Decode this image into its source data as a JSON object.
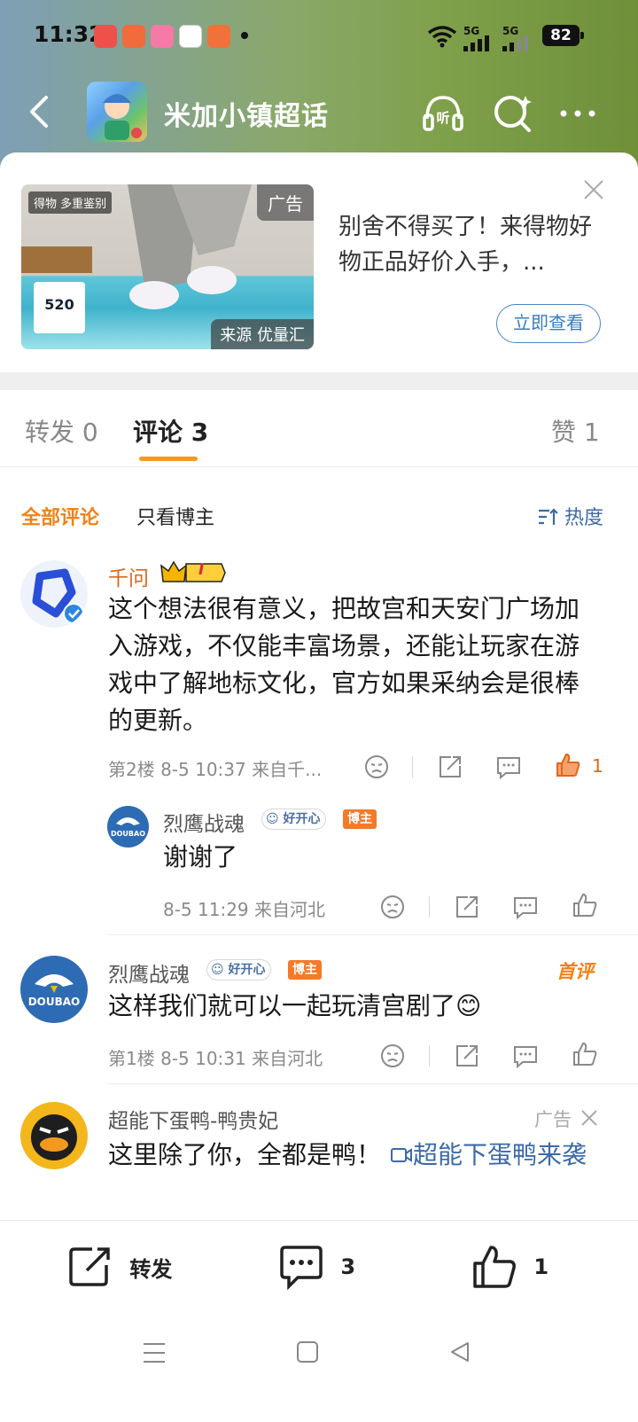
{
  "status_bar": {
    "time": "11:32",
    "signal1": "5G",
    "signal2": "5G",
    "battery": "82"
  },
  "header": {
    "title": "米加小镇超话",
    "listen_label": "听"
  },
  "ad": {
    "tag": "广告",
    "source": "来源 优量汇",
    "brand": "得物 多重鉴别",
    "price": "520",
    "text": "别舍不得买了！来得物好物正品好价入手，...",
    "button": "立即查看"
  },
  "tabs": {
    "repost": "转发 0",
    "comments": "评论 3",
    "likes": "赞 1"
  },
  "filter": {
    "all": "全部评论",
    "blogger_only": "只看博主",
    "sort": "热度"
  },
  "comments": [
    {
      "name": "千问",
      "level": "I",
      "text": "这个想法很有意义，把故宫和天安门广场加入游戏，不仅能丰富场景，还能让玩家在游戏中了解地标文化，官方如果采纳会是很棒的更新。",
      "meta": "第2楼  8-5 10:37  来自千...",
      "like_count": "1",
      "reply": {
        "name": "烈鹰战魂",
        "badge": "好开心",
        "role": "博主",
        "avatar_text": "DOUBAO",
        "text": "谢谢了",
        "meta": "8-5 11:29  来自河北"
      }
    },
    {
      "name": "烈鹰战魂",
      "badge": "好开心",
      "role": "博主",
      "avatar_text": "DOUBAO",
      "first_tag": "首评",
      "text": "这样我们就可以一起玩清宫剧了😊",
      "meta": "第1楼  8-5 10:31  来自河北"
    },
    {
      "name": "超能下蛋鸭-鸭贵妃",
      "ad_tag": "广告",
      "text_plain": "这里除了你，全都是鸭！",
      "text_link": "超能下蛋鸭来袭"
    }
  ],
  "bottom_bar": {
    "repost": "转发",
    "comment_count": "3",
    "like_count": "1"
  }
}
